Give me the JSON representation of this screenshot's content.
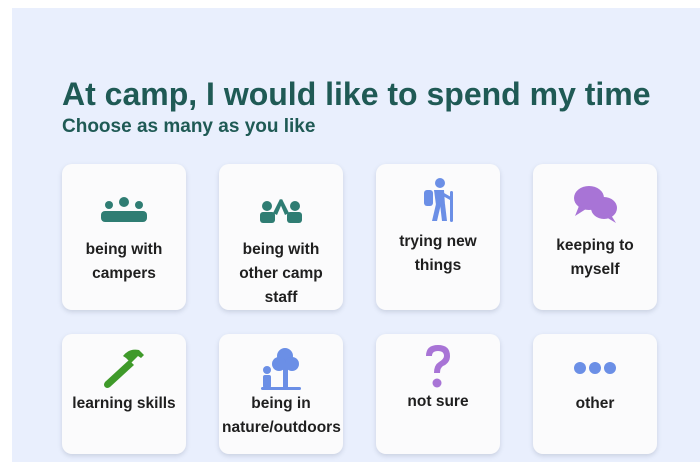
{
  "header": {
    "title": "At camp, I would like to spend my time",
    "subtitle": "Choose as many as you like"
  },
  "options": [
    {
      "label": "being with\ncampers",
      "icon": "group-icon"
    },
    {
      "label": "being with\nother camp\nstaff",
      "icon": "high-five-icon"
    },
    {
      "label": "trying new\nthings",
      "icon": "hiker-icon"
    },
    {
      "label": "keeping to\nmyself",
      "icon": "speech-bubbles-icon"
    },
    {
      "label": "learning skills",
      "icon": "hammer-icon"
    },
    {
      "label": "being in\nnature/outdoors",
      "icon": "tree-person-icon"
    },
    {
      "label": "not sure",
      "icon": "question-mark-icon"
    },
    {
      "label": "other",
      "icon": "dots-icon"
    }
  ],
  "colors": {
    "background": "#e9effd",
    "heading": "#1f5a55",
    "teal": "#2f7d73",
    "blue": "#6b8fe6",
    "purple": "#a874d6",
    "green": "#3f9a2a"
  }
}
